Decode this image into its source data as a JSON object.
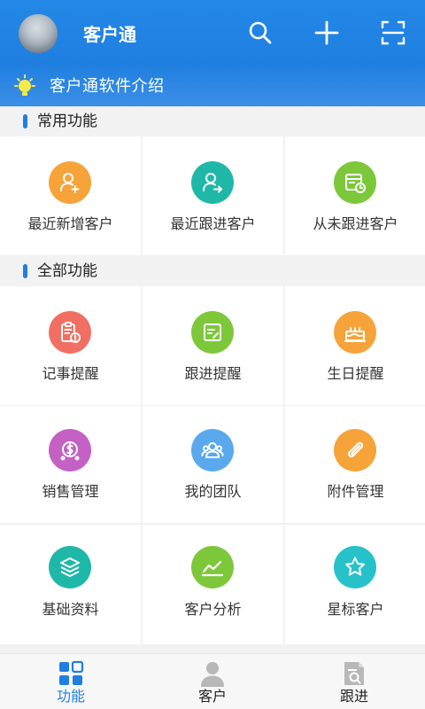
{
  "header": {
    "app_title": "客户通",
    "intro_text": "客户通软件介绍",
    "icons": [
      "search-icon",
      "plus-icon",
      "scan-icon",
      "bulb-icon"
    ]
  },
  "sections": {
    "common_title": "常用功能",
    "all_title": "全部功能"
  },
  "common_items": [
    {
      "label": "最近新增客户",
      "icon": "add-user-icon",
      "color": "#f6a33a"
    },
    {
      "label": "最近跟进客户",
      "icon": "follow-user-icon",
      "color": "#1fb8a8"
    },
    {
      "label": "从未跟进客户",
      "icon": "calendar-clock-icon",
      "color": "#7dc83a"
    }
  ],
  "all_items": [
    {
      "label": "记事提醒",
      "icon": "clipboard-alert-icon",
      "color": "#f16f62"
    },
    {
      "label": "跟进提醒",
      "icon": "note-edit-icon",
      "color": "#7dc83a"
    },
    {
      "label": "生日提醒",
      "icon": "cake-icon",
      "color": "#f6a33a"
    },
    {
      "label": "销售管理",
      "icon": "money-icon",
      "color": "#c361c5"
    },
    {
      "label": "我的团队",
      "icon": "team-icon",
      "color": "#5aa9ec"
    },
    {
      "label": "附件管理",
      "icon": "paperclip-icon",
      "color": "#f6a33a"
    },
    {
      "label": "基础资料",
      "icon": "layers-icon",
      "color": "#1fb8a8"
    },
    {
      "label": "客户分析",
      "icon": "chart-line-icon",
      "color": "#7dc83a"
    },
    {
      "label": "星标客户",
      "icon": "star-icon",
      "color": "#27c1c9"
    }
  ],
  "tabs": [
    {
      "label": "功能",
      "icon": "grid-icon",
      "active": true
    },
    {
      "label": "客户",
      "icon": "person-icon",
      "active": false
    },
    {
      "label": "跟进",
      "icon": "followup-doc-icon",
      "active": false
    }
  ],
  "colors": {
    "primary": "#1f7fe0",
    "tab_active": "#1f7fe0",
    "tab_inactive_icon": "#b8b8b8"
  }
}
